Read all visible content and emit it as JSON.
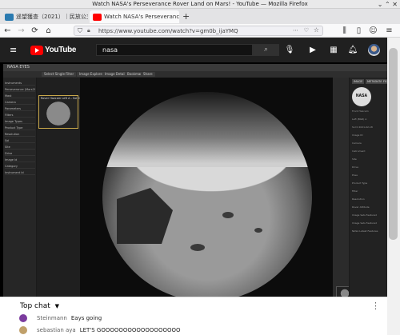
{
  "window": {
    "title": "Watch NASA's Perseverance Rover Land on Mars! - YouTube — Mozilla Firefox"
  },
  "tabs": [
    {
      "label": "遥望獲查（2021）｜民放公立",
      "favicon_color": "#2a7ab0",
      "active": false
    },
    {
      "label": "Watch NASA's Perseveranc",
      "favicon_color": "#ff0000",
      "active": true
    }
  ],
  "browser": {
    "url": "https://www.youtube.com/watch?v=gm0b_ijaYMQ",
    "back_icon": "arrow-left-icon",
    "forward_icon": "arrow-right-icon",
    "reload_icon": "reload-icon",
    "home_icon": "home-icon"
  },
  "youtube": {
    "logo_text": "YouTube",
    "search_value": "nasa",
    "search_icon": "search-icon",
    "header_icons": [
      "mic-icon",
      "create-video-icon",
      "apps-grid-icon",
      "notifications-bell-icon"
    ]
  },
  "video": {
    "app_title": "NASA EYES",
    "toolbar": [
      "Select Single Filter",
      "Image Explorer",
      "Image Details",
      "Bookmark",
      "Share"
    ],
    "left_panel_items": [
      "Instruments",
      "Perseverance (Mars2020)",
      "Mast",
      "Camera",
      "Parameters",
      "Filters",
      "Image Types",
      "Product Type",
      "Resolution",
      "Sol",
      "Site",
      "Drive",
      "Image Id",
      "Category",
      "Instrument Id"
    ],
    "thumb_caption": "Rover Hazcam Left A - Sol 0",
    "right_panel_tabs": [
      "IMAGE",
      "METADATA",
      "FILTERS"
    ],
    "right_panel_rows": [
      "Front Hazcam",
      "Left (BGR) A",
      "Sol 0 2021-02-18",
      "Image ID",
      "Camera",
      "Instrument",
      "Site",
      "Drive",
      "Pose",
      "Product Type",
      "Filter",
      "Resolution",
      "Rover Attitude",
      "Image Sets Featured",
      "Image Sets Featured",
      "NASA Latest Features"
    ],
    "bar_text": "FHAZ Left A 1/1"
  },
  "chat": {
    "title": "Top chat",
    "menu_icon": "more-vert-icon",
    "messages": [
      {
        "author": "Steinmann",
        "text": "Eays going",
        "avatar_color": "#7b3c9e"
      },
      {
        "author": "sebastian aya",
        "text": "LET'S GOOOOOOOOOOOOOOOOOO",
        "avatar_color": "#c0a06a"
      }
    ]
  }
}
